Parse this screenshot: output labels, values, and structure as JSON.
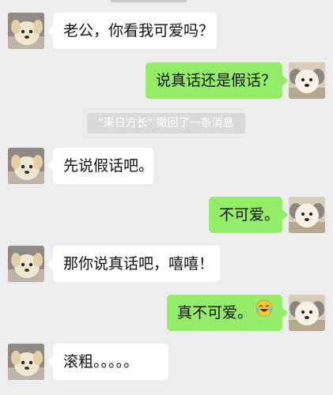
{
  "messages": [
    {
      "side": "left",
      "text": "老公，你看我可爱吗？"
    },
    {
      "side": "right",
      "text": "说真话还是假话？"
    },
    {
      "side": "left",
      "text": "先说假话吧。"
    },
    {
      "side": "right",
      "text": "不可爱。"
    },
    {
      "side": "left",
      "text": "那你说真话吧，嘻嘻！"
    },
    {
      "side": "right",
      "text": "真不可爱。",
      "emoji": "laughing-crying-emoji"
    },
    {
      "side": "left",
      "text": "滚粗。。。。。"
    }
  ],
  "system_notice": {
    "quoted_name": "\"来日方长\"",
    "action_text": " 撤回了一条消息"
  },
  "colors": {
    "background": "#ededed",
    "incoming_bubble": "#ffffff",
    "outgoing_bubble": "#95ec69",
    "notice_bg": "#dadada"
  },
  "icons": {
    "left_avatar": "puppy-avatar-icon",
    "right_avatar": "fluffy-dog-avatar-icon"
  }
}
